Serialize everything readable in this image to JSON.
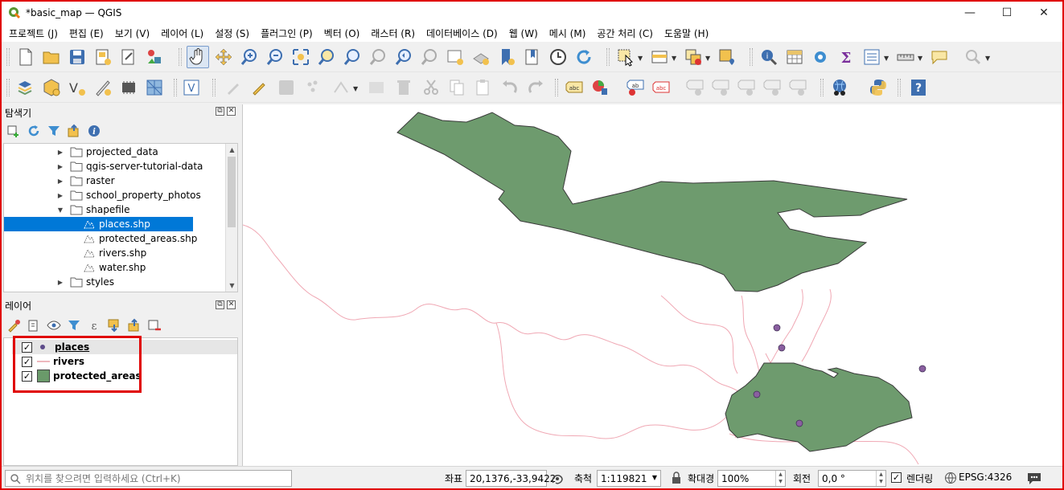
{
  "window": {
    "title": "*basic_map — QGIS",
    "minimize": "—",
    "maximize": "☐",
    "close": "✕"
  },
  "menubar": {
    "items": [
      "프로젝트 (J)",
      "편집 (E)",
      "보기 (V)",
      "레이어 (L)",
      "설정 (S)",
      "플러그인 (P)",
      "벡터 (O)",
      "래스터 (R)",
      "데이터베이스 (D)",
      "웹 (W)",
      "메시 (M)",
      "공간 처리 (C)",
      "도움말 (H)"
    ]
  },
  "browser_panel": {
    "title": "탐색기",
    "items": [
      {
        "label": "projected_data",
        "type": "folder",
        "expanded": false
      },
      {
        "label": "qgis-server-tutorial-data",
        "type": "folder",
        "expanded": false
      },
      {
        "label": "raster",
        "type": "folder",
        "expanded": false
      },
      {
        "label": "school_property_photos",
        "type": "folder",
        "expanded": false
      },
      {
        "label": "shapefile",
        "type": "folder",
        "expanded": true
      },
      {
        "label": "places.shp",
        "type": "shp",
        "selected": true
      },
      {
        "label": "protected_areas.shp",
        "type": "shp"
      },
      {
        "label": "rivers.shp",
        "type": "shp"
      },
      {
        "label": "water.shp",
        "type": "shp"
      },
      {
        "label": "styles",
        "type": "folder",
        "expanded": false
      }
    ]
  },
  "layers_panel": {
    "title": "레이어",
    "layers": [
      {
        "name": "places",
        "checked": true,
        "symbol": "point",
        "color": "#7b5aa6"
      },
      {
        "name": "rivers",
        "checked": true,
        "symbol": "line",
        "color": "#e8a0a8"
      },
      {
        "name": "protected_areas",
        "checked": true,
        "symbol": "polygon",
        "color": "#6a9a6a"
      }
    ],
    "check_mark": "✓"
  },
  "map": {
    "polygon_fill": "#6e9b6e",
    "polygon_stroke": "#3a3a3a",
    "river_color": "#f0a8b4",
    "point_fill": "#8a5fa0"
  },
  "statusbar": {
    "locator_placeholder": "위치를 찾으려면 입력하세요 (Ctrl+K)",
    "coord_label": "좌표",
    "coord_value": "20,1376,-33,9422",
    "scale_label": "축척",
    "scale_value": "1:119821",
    "magnifier_label": "확대경",
    "magnifier_value": "100%",
    "rotation_label": "회전",
    "rotation_value": "0,0 °",
    "render_label": "렌더링",
    "render_checked": "✓",
    "crs": "EPSG:4326"
  }
}
